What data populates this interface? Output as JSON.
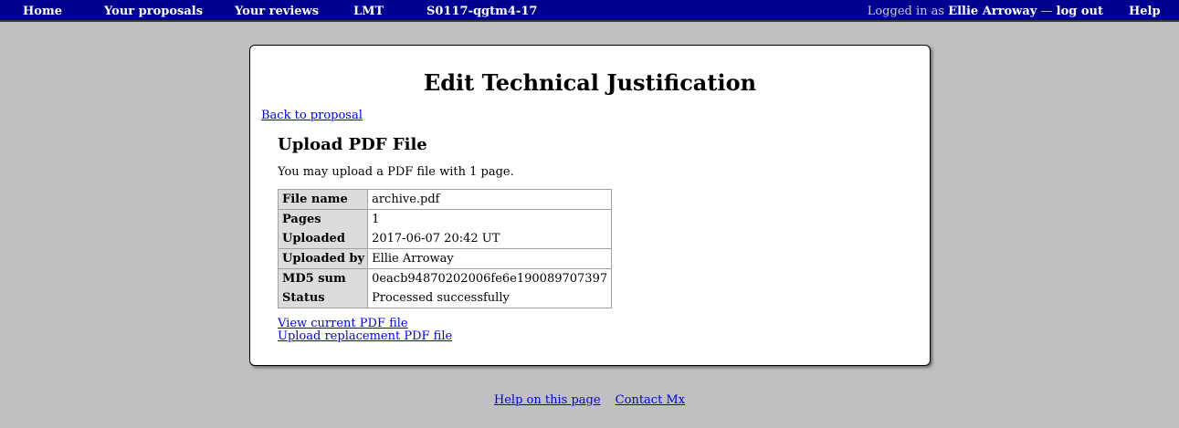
{
  "nav": {
    "home": "Home",
    "proposals": "Your proposals",
    "reviews": "Your reviews",
    "facility": "LMT",
    "proposal_code": "S0117-qgtm4-17",
    "logged_in_prefix": "Logged in as",
    "user_name": "Ellie Arroway",
    "dash": "—",
    "logout": "log out",
    "help": "Help"
  },
  "page": {
    "title": "Edit Technical Justification",
    "back_link": "Back to proposal",
    "section_title": "Upload PDF File",
    "intro": "You may upload a PDF file with 1 page."
  },
  "file_info": {
    "rows": [
      {
        "label": "File name",
        "value": "archive.pdf"
      },
      {
        "label": "Pages",
        "value": "1"
      },
      {
        "label": "Uploaded",
        "value": "2017-06-07 20:42 UT"
      },
      {
        "label": "Uploaded by",
        "value": "Ellie Arroway"
      },
      {
        "label": "MD5 sum",
        "value": "0eacb94870202006fe6e190089707397"
      },
      {
        "label": "Status",
        "value": "Processed successfully"
      }
    ]
  },
  "actions": {
    "view_pdf": "View current PDF file",
    "upload_replacement": "Upload replacement PDF file"
  },
  "footer": {
    "help_page": "Help on this page",
    "contact": "Contact Mx"
  },
  "colors": {
    "nav_bg": "#000090",
    "page_bg": "#c0c0c0",
    "link": "#0000ee",
    "table_header_bg": "#dcdcdc"
  }
}
